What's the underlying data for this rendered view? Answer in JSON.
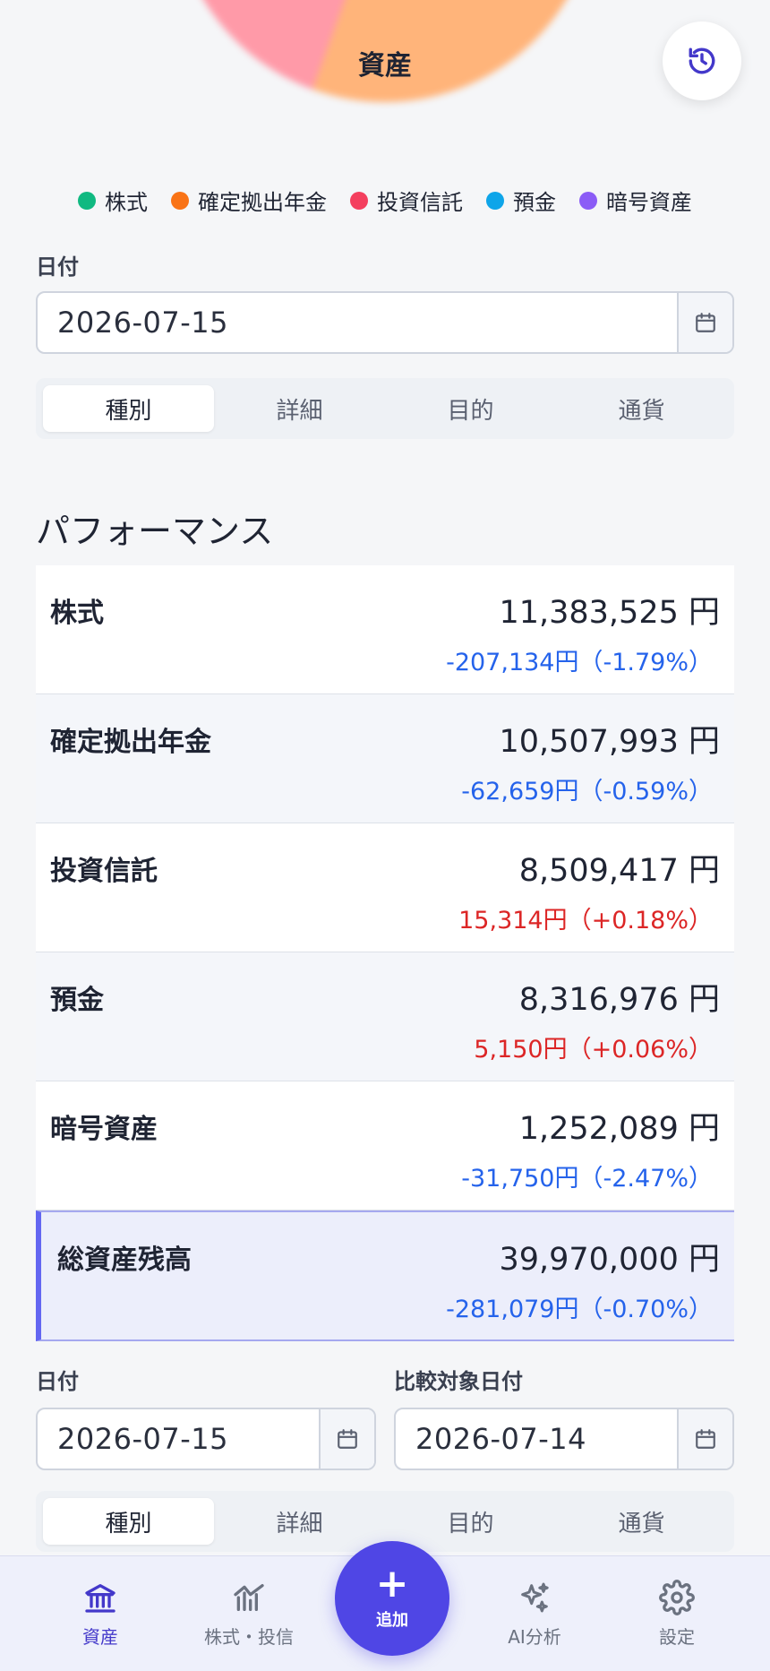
{
  "header": {
    "pie_center_label": "資産"
  },
  "legend": [
    {
      "label": "株式",
      "color": "#10b981"
    },
    {
      "label": "確定拠出年金",
      "color": "#f97316"
    },
    {
      "label": "投資信託",
      "color": "#f43f5e"
    },
    {
      "label": "預金",
      "color": "#0ea5e9"
    },
    {
      "label": "暗号資産",
      "color": "#8b5cf6"
    }
  ],
  "filter_top": {
    "date_label": "日付",
    "date_value": "2026-07-15",
    "tabs": [
      "種別",
      "詳細",
      "目的",
      "通貨"
    ],
    "active_tab": "種別"
  },
  "performance": {
    "title": "パフォーマンス",
    "rows": [
      {
        "name": "株式",
        "amount": "11,383,525 円",
        "diff": "-207,134円（-1.79%）",
        "direction": "neg"
      },
      {
        "name": "確定拠出年金",
        "amount": "10,507,993 円",
        "diff": "-62,659円（-0.59%）",
        "direction": "neg"
      },
      {
        "name": "投資信託",
        "amount": "8,509,417 円",
        "diff": "15,314円（+0.18%）",
        "direction": "pos"
      },
      {
        "name": "預金",
        "amount": "8,316,976 円",
        "diff": "5,150円（+0.06%）",
        "direction": "pos"
      },
      {
        "name": "暗号資産",
        "amount": "1,252,089 円",
        "diff": "-31,750円（-2.47%）",
        "direction": "neg"
      }
    ],
    "total": {
      "name": "総資産残高",
      "amount": "39,970,000 円",
      "diff": "-281,079円（-0.70%）",
      "direction": "neg"
    }
  },
  "filter_compare": {
    "date_label": "日付",
    "date_value": "2026-07-15",
    "compare_label": "比較対象日付",
    "compare_value": "2026-07-14",
    "tabs": [
      "種別",
      "詳細",
      "目的",
      "通貨"
    ],
    "active_tab": "種別"
  },
  "bottom_nav": {
    "items": [
      {
        "label": "資産",
        "icon": "bank-icon",
        "active": true
      },
      {
        "label": "株式・投信",
        "icon": "stock-chart-icon",
        "active": false
      },
      {
        "label": "AI分析",
        "icon": "sparkles-icon",
        "active": false
      },
      {
        "label": "設定",
        "icon": "gear-icon",
        "active": false
      }
    ],
    "fab_label": "追加"
  },
  "colors": {
    "accent": "#4f46e5",
    "negative": "#2563eb",
    "positive": "#dc2626"
  }
}
